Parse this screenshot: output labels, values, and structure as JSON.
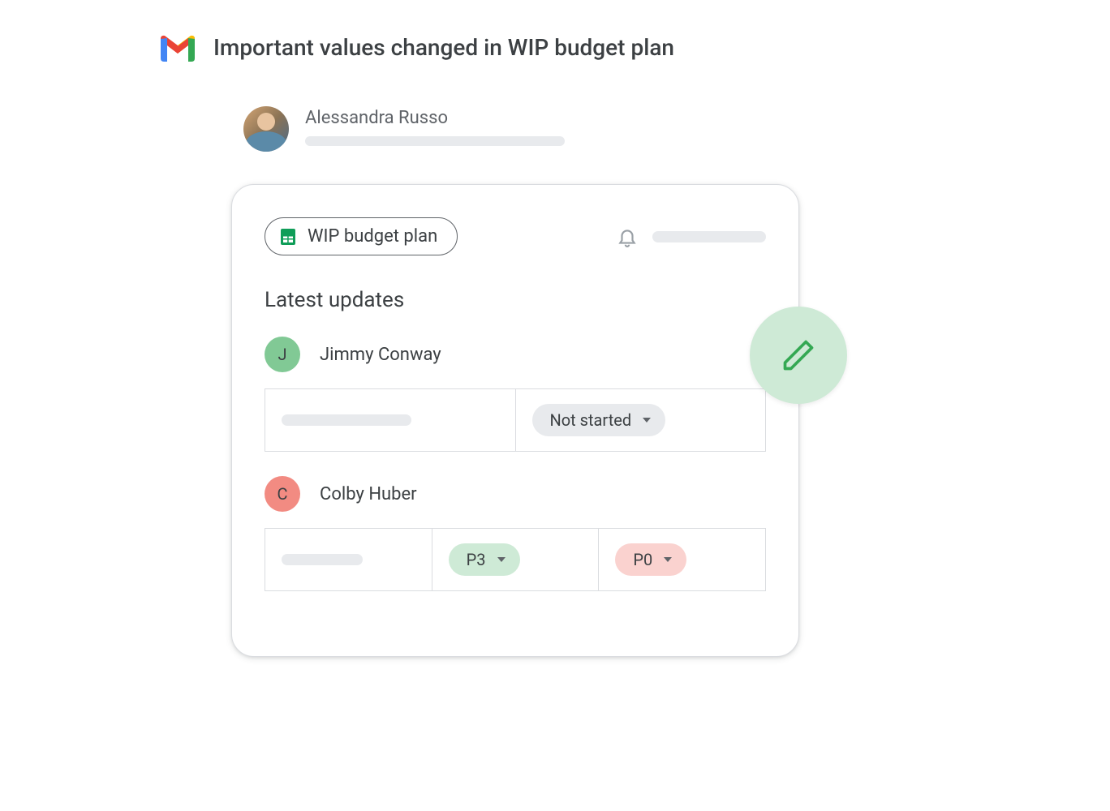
{
  "email": {
    "subject": "Important values changed in WIP budget plan",
    "sender_name": "Alessandra Russo"
  },
  "card": {
    "file_name": "WIP budget plan",
    "section_title": "Latest updates",
    "updates": [
      {
        "initial": "J",
        "name": "Jimmy Conway",
        "status": "Not started"
      },
      {
        "initial": "C",
        "name": "Colby Huber",
        "priority_from": "P3",
        "priority_to": "P0"
      }
    ]
  }
}
